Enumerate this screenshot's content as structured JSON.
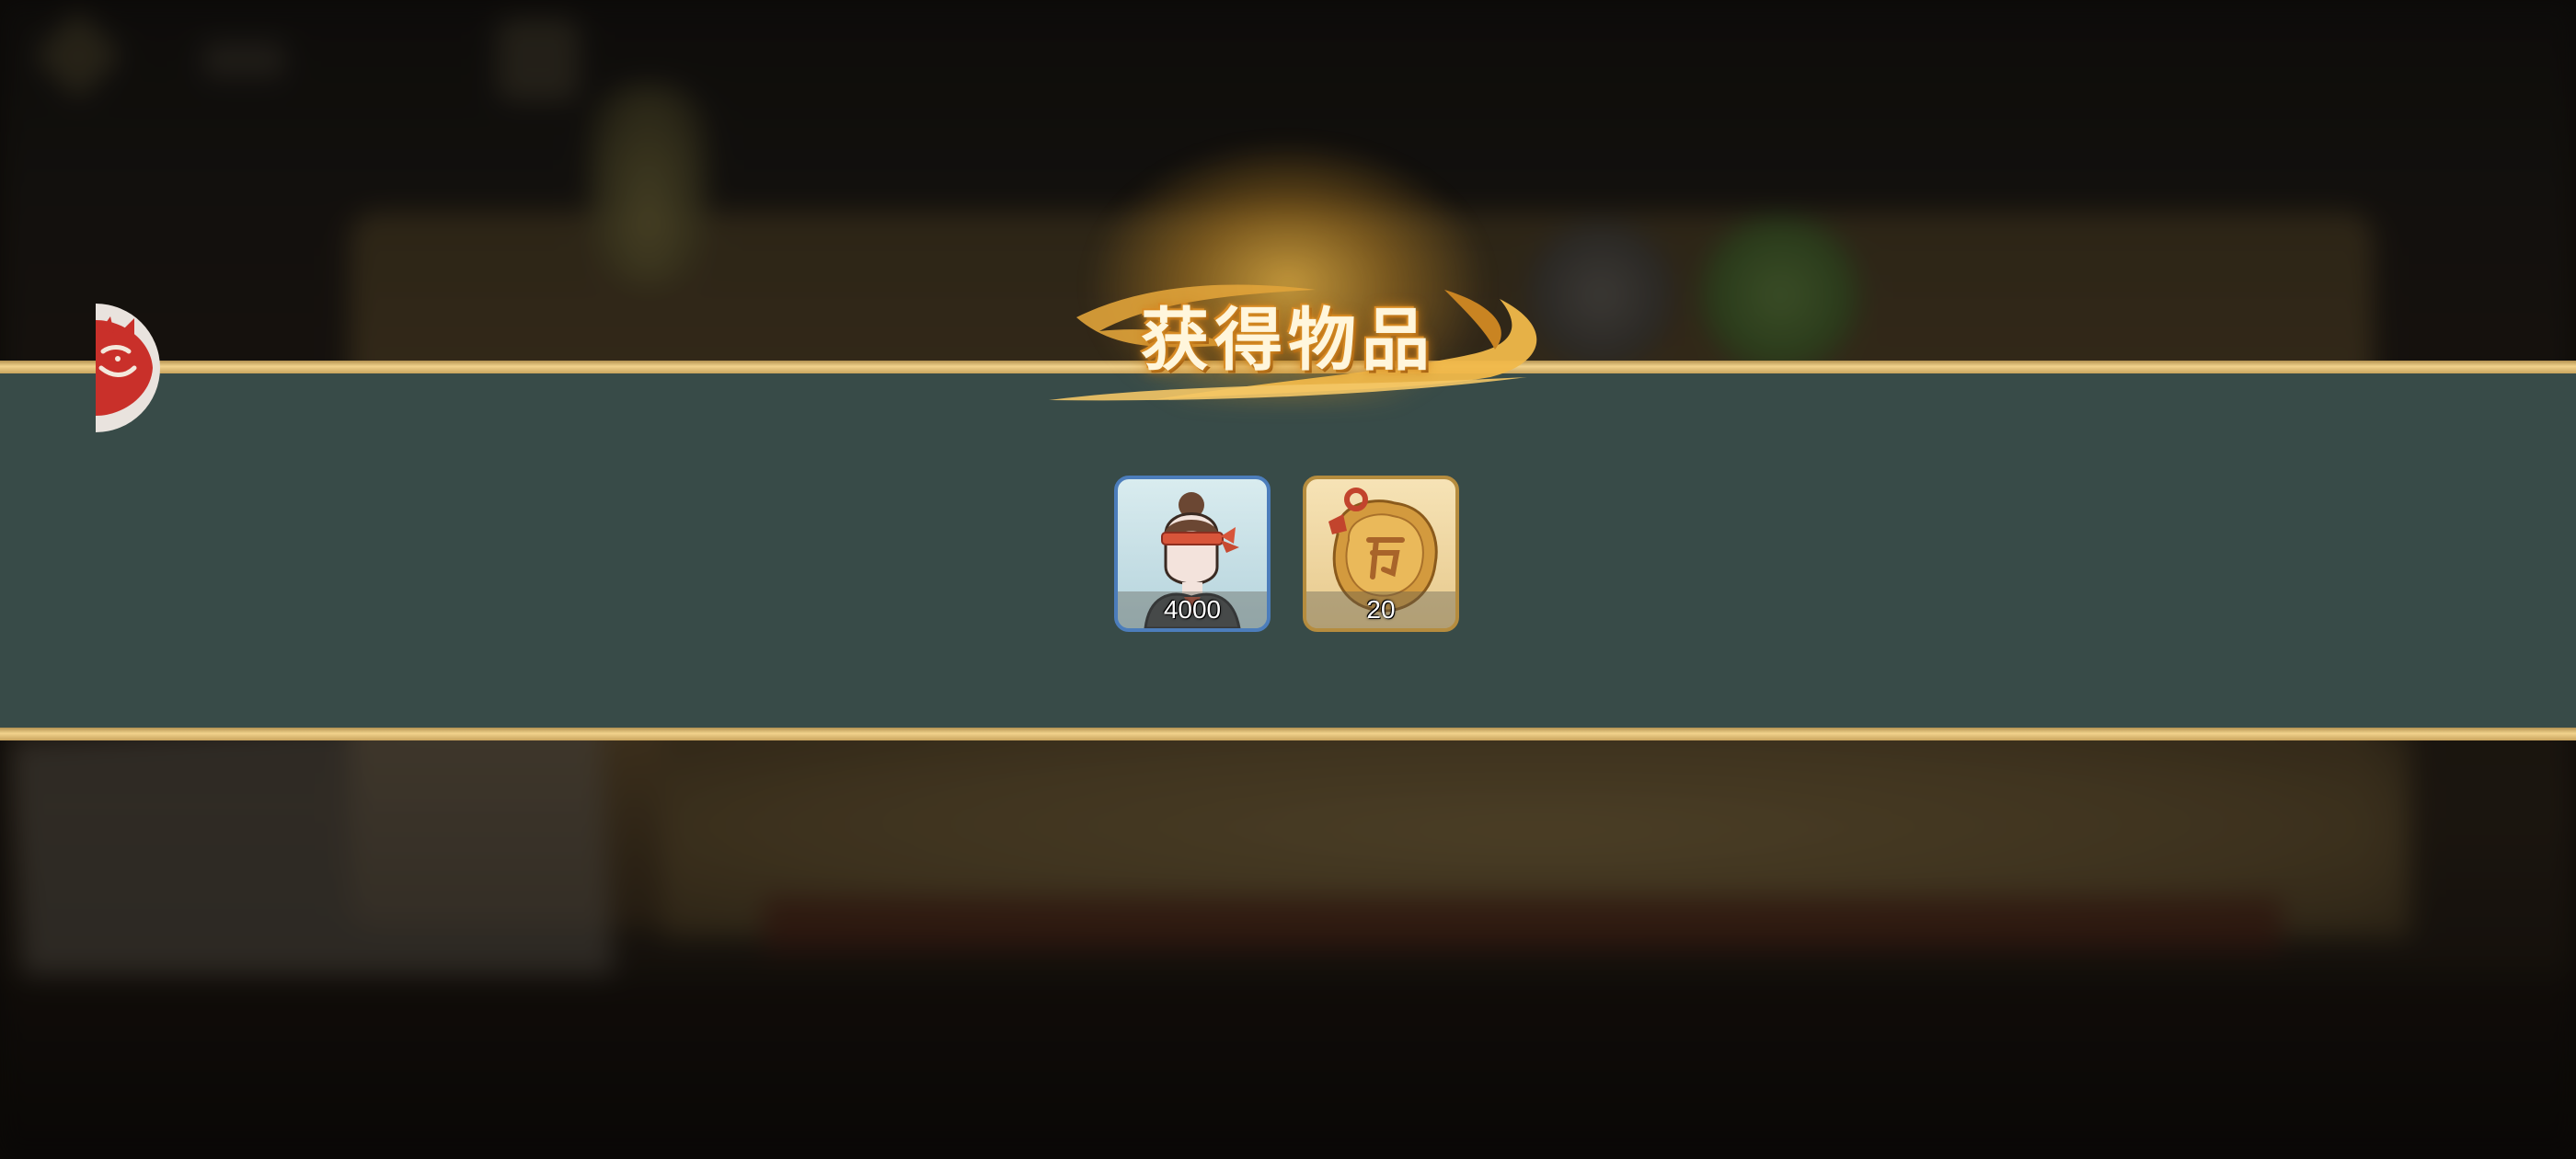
{
  "reward_popup": {
    "title": "获得物品",
    "items": [
      {
        "icon": "hero-portrait-icon",
        "count": "4000",
        "frame_color": "#4c7dbb"
      },
      {
        "icon": "gold-token-icon",
        "count": "20",
        "frame_color": "#b58c3e"
      }
    ]
  },
  "side_avatar": {
    "icon": "red-demon-mask-icon"
  },
  "colors": {
    "band": "#384b48",
    "band_edge": "#f1d28c",
    "title_glow": "#f6be48",
    "title_text": "#fff6dc"
  }
}
